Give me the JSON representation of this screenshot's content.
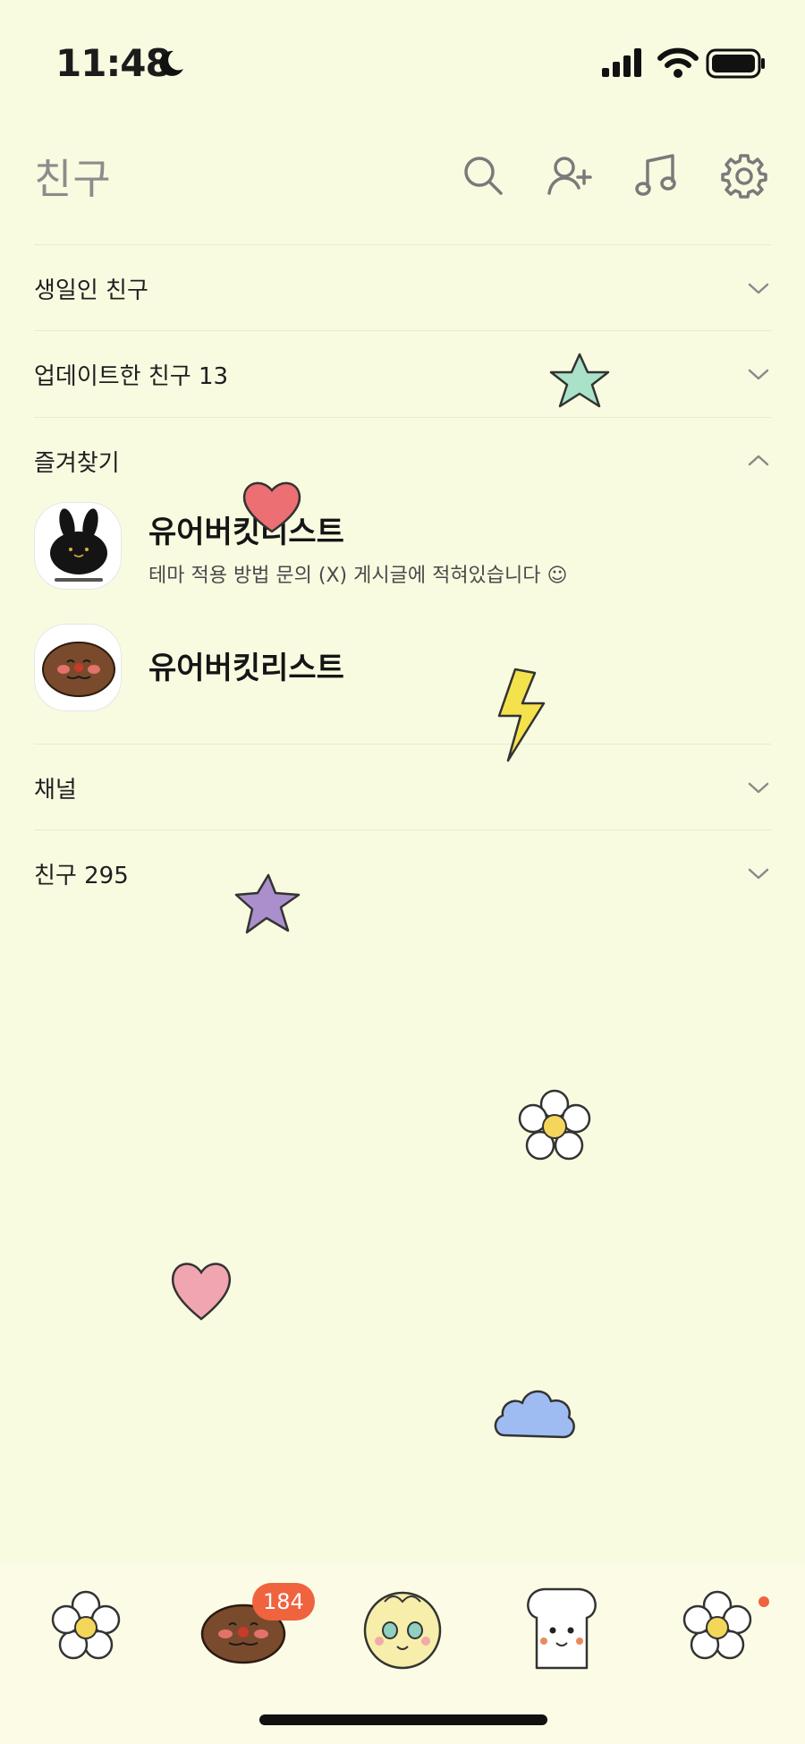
{
  "status_bar": {
    "time": "11:48"
  },
  "header": {
    "title": "친구",
    "icons": [
      "search-icon",
      "add-friend-icon",
      "music-icon",
      "settings-icon"
    ]
  },
  "sections": {
    "birthday": {
      "label": "생일인 친구",
      "expanded": false
    },
    "updated": {
      "label": "업데이트한 친구 13",
      "expanded": false
    },
    "favorites": {
      "label": "즐겨찾기",
      "expanded": true
    },
    "channel": {
      "label": "채널",
      "expanded": false
    },
    "friends": {
      "label": "친구 295",
      "expanded": false
    }
  },
  "favorites": [
    {
      "name": "유어버킷리스트",
      "status": "테마 적용 방법 문의 (X) 게시글에 적혀있습니다 ☺",
      "avatar": "black-bunny-avatar"
    },
    {
      "name": "유어버킷리스트",
      "status": "",
      "avatar": "brown-bread-avatar"
    }
  ],
  "stickers": [
    "mint-star",
    "red-heart",
    "yellow-lightning",
    "purple-star",
    "white-flower",
    "pink-heart",
    "blue-cloud"
  ],
  "bottom_nav": {
    "tabs": [
      "flower-tab",
      "chat-tab",
      "face-tab",
      "toast-tab",
      "more-flower-tab"
    ],
    "chat_badge": "184",
    "accent": "#f0633f"
  },
  "colors": {
    "background": "#f9fbe1",
    "nav_background": "#fcfce6",
    "divider": "#e9ebd0"
  }
}
